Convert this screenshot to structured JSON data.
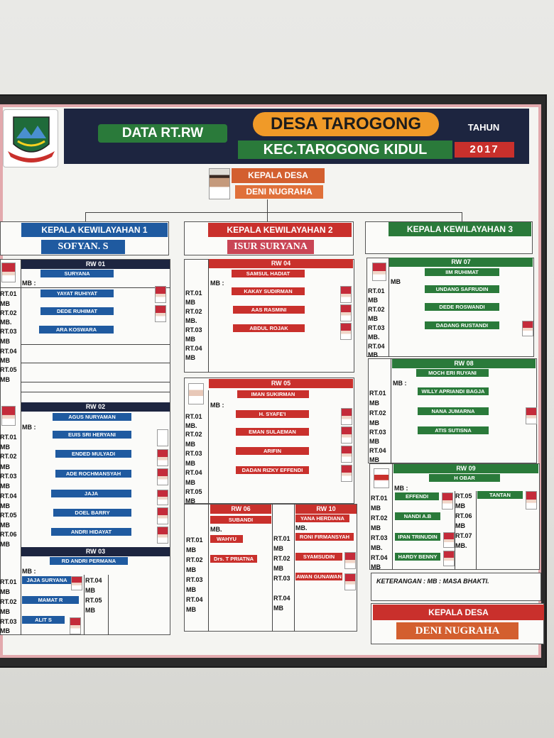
{
  "header": {
    "title_left": "DATA RT.RW",
    "title_main": "DESA TAROGONG",
    "title_sub": "KEC.TAROGONG KIDUL",
    "year_label": "TAHUN",
    "year": "2017"
  },
  "kepala_desa": {
    "title": "KEPALA DESA",
    "name": "DENI NUGRAHA"
  },
  "wilayah": [
    {
      "title": "KEPALA KEWILAYAHAN 1",
      "name": "SOFYAN. S"
    },
    {
      "title": "KEPALA KEWILAYAHAN 2",
      "name": "ISUR SURYANA"
    },
    {
      "title": "KEPALA KEWILAYAHAN 3",
      "name": ""
    }
  ],
  "rw": {
    "rw01": {
      "title": "RW 01",
      "head": "SURYANA",
      "rts": [
        "YAYAT RUHIYAT",
        "DEDE RUHIMAT",
        "ARA KOSWARA"
      ]
    },
    "rw02": {
      "title": "RW 02",
      "head": "AGUS NURYAMAN",
      "rts": [
        "EUIS SRI HERYANI",
        "ENDED MULYADI",
        "ADE ROCHMANSYAH",
        "JAJA",
        "DOEL BARRY",
        "ANDRI HIDAYAT"
      ]
    },
    "rw03": {
      "title": "RW 03",
      "head": "RD ANDRI PERMANA",
      "rts": [
        "JAJA SURYANA",
        "MAMAT R",
        "ALIT S"
      ]
    },
    "rw04": {
      "title": "RW 04",
      "head": "SAMSUL HADIAT",
      "rts": [
        "KAKAY SUDIRMAN",
        "AAS RASMINI",
        "ABDUL ROJAK"
      ]
    },
    "rw05": {
      "title": "RW 05",
      "head": "IMAN SUKIRMAN",
      "rts": [
        "H. SYAFE'I",
        "EMAN SULAEMAN",
        "ARIFIN",
        "DADAN RIZKY EFFENDI"
      ]
    },
    "rw06": {
      "title": "RW 06",
      "head": "SUBANDI",
      "rts": [
        "WAHYU",
        "Drs. T PRIATNA"
      ]
    },
    "rw10": {
      "title": "RW 10",
      "head": "YANA HERDIANA",
      "rts": [
        "RONI FIRMANSYAH",
        "SYAMSUDIN",
        "AWAN GUNAWAN"
      ]
    },
    "rw07": {
      "title": "RW 07",
      "head": "IIM RUHIMAT",
      "rts": [
        "UNDANG SAFRUDIN",
        "DEDE ROSWANDI",
        "DADANG RUSTANDI"
      ]
    },
    "rw08": {
      "title": "RW 08",
      "head": "MOCH ERI RUYANI",
      "rts": [
        "WILLY APRIANDI BAGJA",
        "NANA JUMARNA",
        "ATIS SUTISNA"
      ]
    },
    "rw09": {
      "title": "RW 09",
      "head": "H OBAR",
      "rts": [
        "EFFENDI",
        "TANTAN",
        "NANDI A.B",
        "IPAN TRINUDIN",
        "HARDY BENNY"
      ]
    }
  },
  "labels": {
    "rt01": "RT.01",
    "rt02": "RT.02",
    "rt03": "RT.03",
    "rt04": "RT.04",
    "rt05": "RT.05",
    "rt06": "RT.06",
    "rt07": "RT.07",
    "mb": "MB",
    "mb_colon": "MB :",
    "mb_dot": "MB."
  },
  "keterangan": "KETERANGAN : MB : MASA BHAKTI.",
  "footer_kepala": {
    "title": "KEPALA DESA",
    "name": "DENI NUGRAHA"
  },
  "colors": {
    "navy": "#1d2540",
    "blue": "#1f5aa0",
    "red": "#c9302c",
    "green": "#2a7a3a",
    "orange": "#e8832a",
    "frame_pink": "#e2a9ad"
  }
}
